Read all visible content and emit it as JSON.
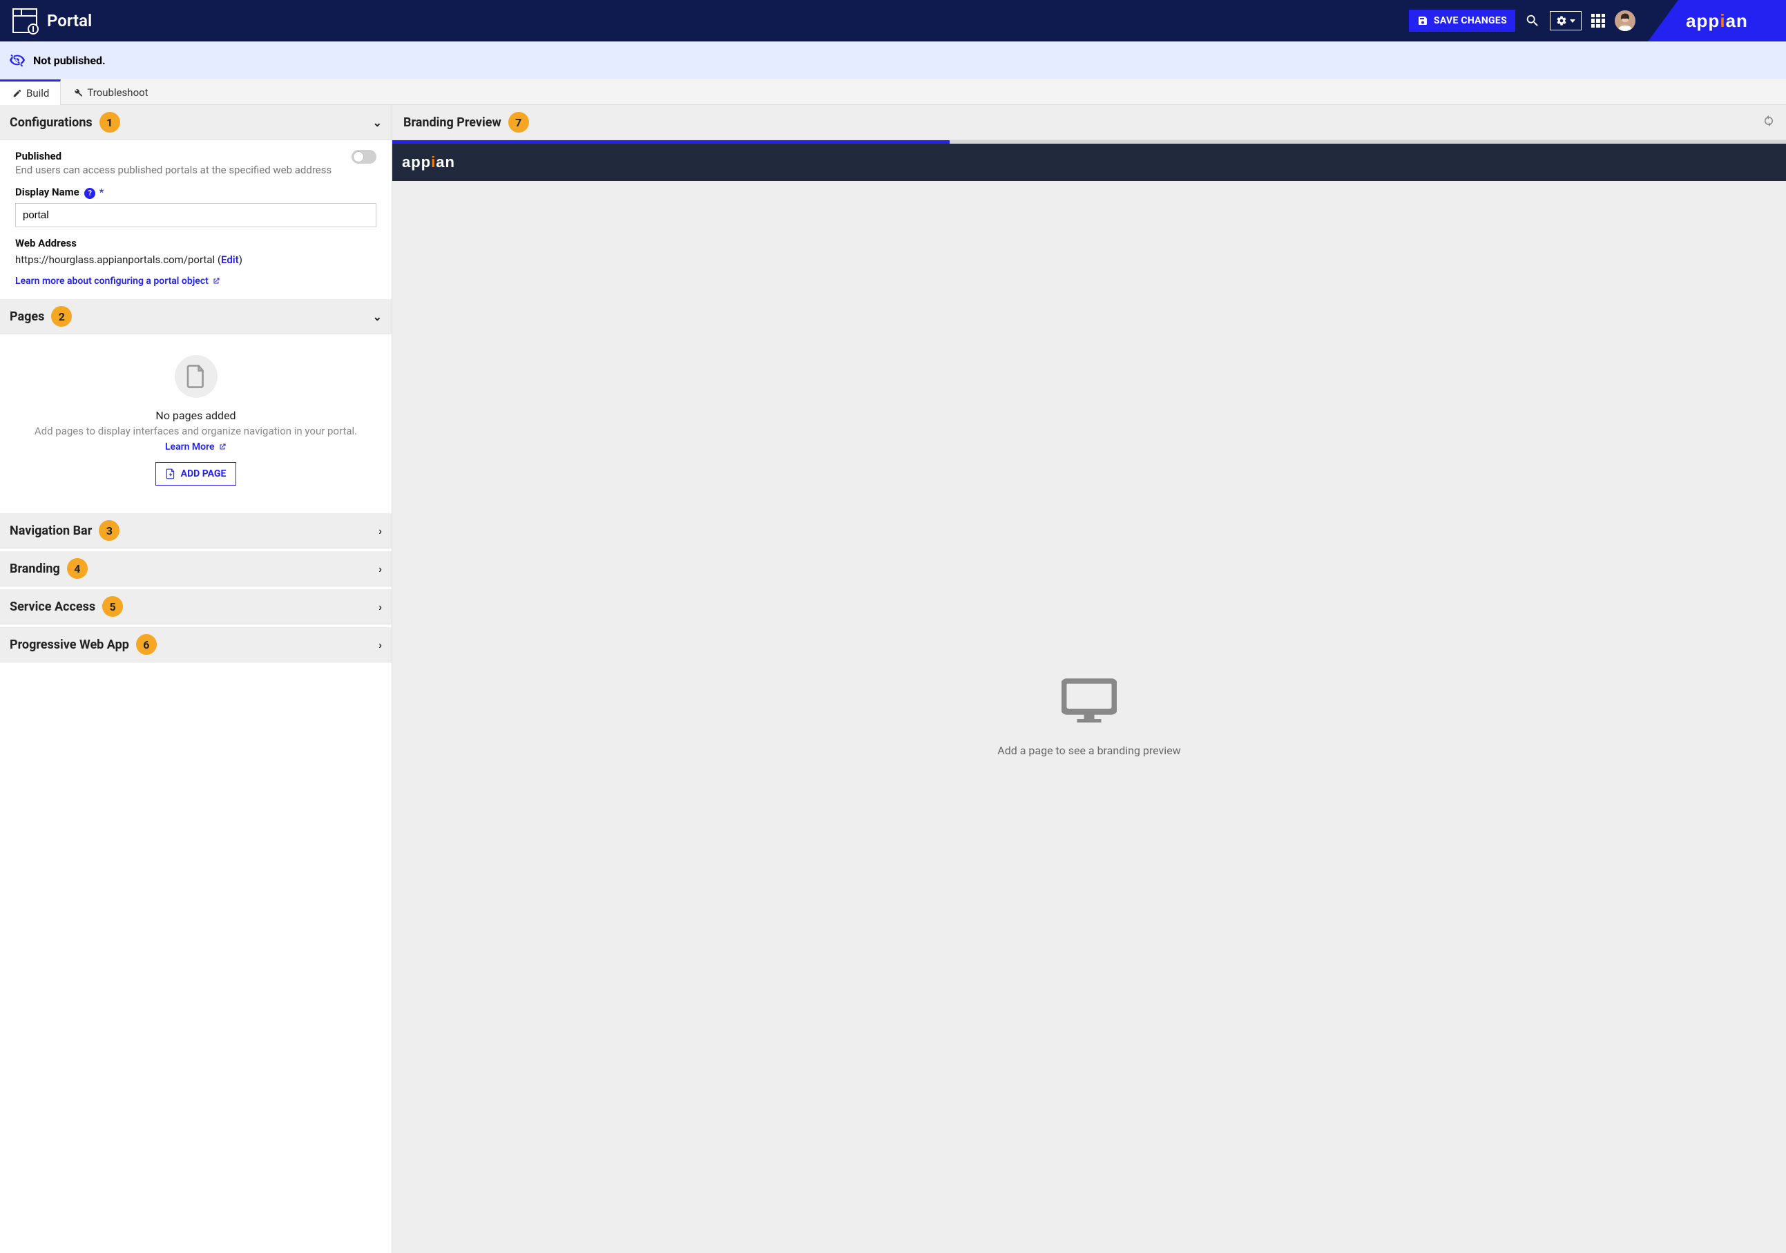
{
  "header": {
    "title": "Portal",
    "save_label": "SAVE CHANGES",
    "brand": "appian"
  },
  "status": {
    "text": "Not published."
  },
  "tabs": {
    "build": "Build",
    "troubleshoot": "Troubleshoot"
  },
  "sections": {
    "configurations": {
      "title": "Configurations",
      "callout": "1",
      "published_label": "Published",
      "published_desc": "End users can access published portals at the specified web address",
      "display_name_label": "Display Name",
      "display_name_value": "portal",
      "web_address_label": "Web Address",
      "web_address_value": "https://hourglass.appianportals.com/portal (",
      "web_address_edit": "Edit",
      "web_address_close": ")",
      "learn_link": "Learn more about configuring a portal object"
    },
    "pages": {
      "title": "Pages",
      "callout": "2",
      "empty_title": "No pages added",
      "empty_desc": "Add pages to display interfaces and organize navigation in your portal.",
      "learn_more": "Learn More",
      "add_page": "ADD PAGE"
    },
    "navigation": {
      "title": "Navigation Bar",
      "callout": "3"
    },
    "branding": {
      "title": "Branding",
      "callout": "4"
    },
    "service": {
      "title": "Service Access",
      "callout": "5"
    },
    "pwa": {
      "title": "Progressive Web App",
      "callout": "6"
    }
  },
  "preview": {
    "title": "Branding Preview",
    "callout": "7",
    "brand": "appian",
    "hint": "Add a page to see a branding preview"
  }
}
